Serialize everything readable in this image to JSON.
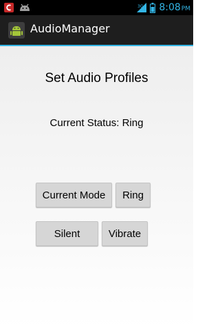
{
  "status_bar": {
    "time": "8:08",
    "ampm": "PM",
    "icons": [
      "notification-app-icon",
      "android-debug-icon",
      "signal-icon",
      "battery-icon"
    ]
  },
  "action_bar": {
    "title": "AudioManager",
    "icon": "android-app-icon"
  },
  "main": {
    "heading": "Set Audio Profiles",
    "status_text": "Current Status: Ring",
    "buttons": {
      "current_mode": "Current Mode",
      "ring": "Ring",
      "silent": "Silent",
      "vibrate": "Vibrate"
    }
  },
  "colors": {
    "accent": "#33b5e5",
    "action_bar_bg": "#1e1e1e",
    "button_bg": "#d6d6d6"
  }
}
